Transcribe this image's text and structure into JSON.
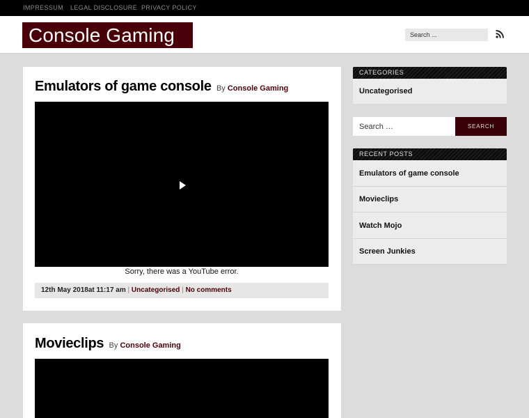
{
  "topnav": [
    "IMPRESSUM",
    "LEGAL DISCLOSURE",
    "PRIVACY POLICY"
  ],
  "header": {
    "logo": "Console Gaming",
    "search_placeholder": "Search ...",
    "rss_icon": "rss-icon"
  },
  "posts": [
    {
      "title": "Emulators of game console",
      "by": "By",
      "author": "Console Gaming",
      "video_error": "Sorry, there was a YouTube error.",
      "date": "12th May 2018at 11:17 am",
      "category": "Uncategorised",
      "comments": "No comments",
      "separator": "|"
    },
    {
      "title": "Movieclips",
      "by": "By",
      "author": "Console Gaming"
    }
  ],
  "sidebar": {
    "categories_title": "CATEGORIES",
    "categories": [
      "Uncategorised"
    ],
    "search_placeholder": "Search …",
    "search_button": "SEARCH",
    "recent_title": "RECENT POSTS",
    "recent_posts": [
      "Emulators of game console",
      "Movieclips",
      "Watch Mojo",
      "Screen Junkies"
    ]
  },
  "colors": {
    "brand": "#4a0008",
    "topbar": "#000000",
    "background": "#dcdcdc"
  }
}
